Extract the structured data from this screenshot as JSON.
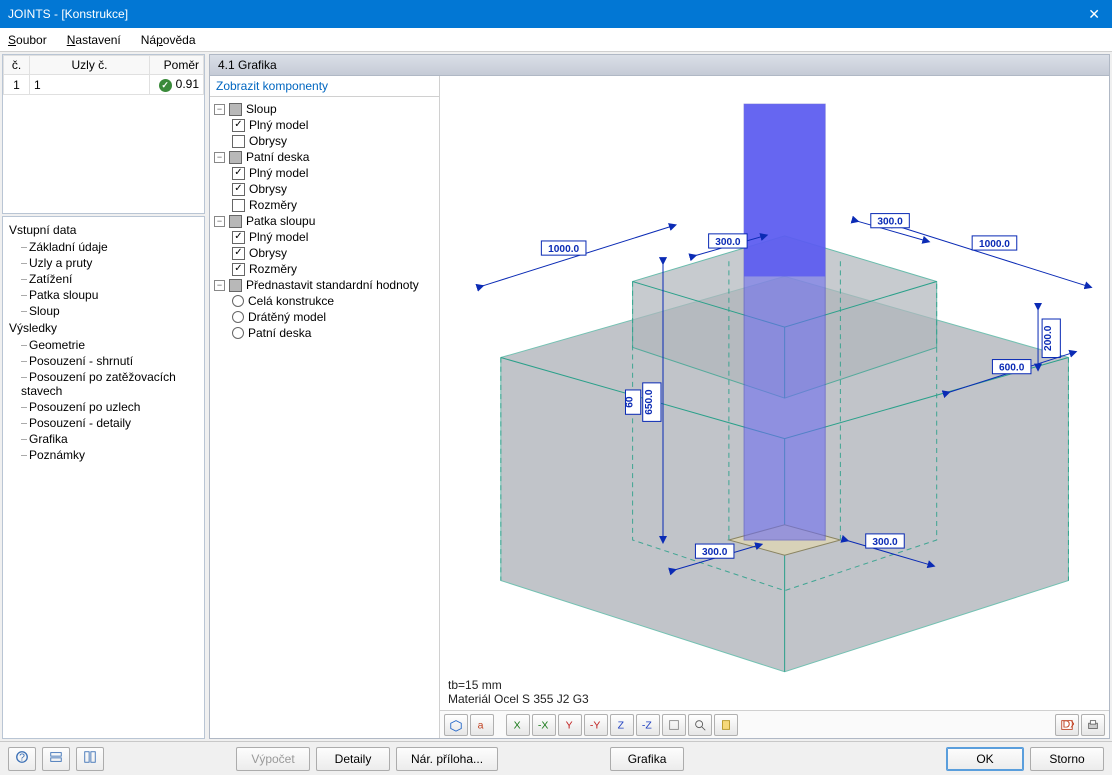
{
  "window": {
    "title": "JOINTS - [Konstrukce]"
  },
  "menu": {
    "file": "Soubor",
    "settings": "Nastavení",
    "help": "Nápověda"
  },
  "top_table": {
    "col_no": "č.",
    "col_nodes": "Uzly č.",
    "col_ratio": "Poměr",
    "rows": [
      {
        "no": "1",
        "nodes": "1",
        "ratio": "0.91"
      }
    ]
  },
  "nav": {
    "input_heading": "Vstupní data",
    "input_items": [
      "Základní údaje",
      "Uzly a pruty",
      "Zatížení",
      "Patka sloupu",
      "Sloup"
    ],
    "results_heading": "Výsledky",
    "results_items": [
      "Geometrie",
      "Posouzení - shrnutí",
      "Posouzení po zatěžovacích stavech",
      "Posouzení po uzlech",
      "Posouzení - detaily",
      "Grafika",
      "Poznámky"
    ]
  },
  "panel": {
    "heading": "4.1 Grafika",
    "components_title": "Zobrazit komponenty",
    "tree": {
      "sloup": "Sloup",
      "plny_model": "Plný model",
      "obrysy": "Obrysy",
      "patni_deska": "Patní deska",
      "rozmery": "Rozměry",
      "patka_sloupu": "Patka sloupu",
      "predvolby": "Přednastavit standardní hodnoty",
      "cela_konstrukce": "Celá konstrukce",
      "drateny_model": "Drátěný model",
      "r_patni_deska": "Patní deska"
    }
  },
  "gfx": {
    "tb_line": "tb=15 mm",
    "mat_line": "Materiál Ocel S 355 J2 G3",
    "dims": {
      "d1000_l": "1000.0",
      "d1000_r": "1000.0",
      "d300_top_l": "300.0",
      "d300_top_r": "300.0",
      "d650": "650.0",
      "d60": "60",
      "d200": "200.0",
      "d600": "600.0",
      "d300_bot_l": "300.0",
      "d300_bot_r": "300.0"
    }
  },
  "toolbar": {
    "axo": "axo-view",
    "labels": "text-labels",
    "x1": "view-x",
    "x2": "view-neg-x",
    "y1": "view-y",
    "y2": "view-neg-y",
    "z1": "view-z",
    "z2": "view-neg-z",
    "cube": "fit-view",
    "zoom": "zoom",
    "clip": "clipboard",
    "dxf": "export-dxf",
    "print": "print"
  },
  "bottom": {
    "help": "help",
    "tile_h": "tile-horizontal",
    "tile_v": "tile-vertical",
    "calc": "Výpočet",
    "details": "Detaily",
    "attach": "Nár. příloha...",
    "graphics": "Grafika",
    "ok": "OK",
    "cancel": "Storno"
  }
}
